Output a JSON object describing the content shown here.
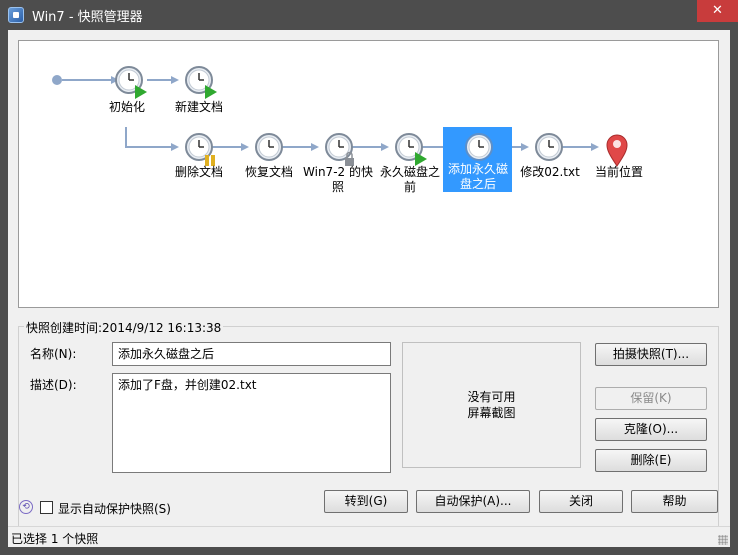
{
  "window": {
    "title": "Win7 - 快照管理器",
    "close_glyph": "✕"
  },
  "snapshots": {
    "root": "初始化",
    "new_doc": "新建文档",
    "delete_doc": "删除文档",
    "restore_doc": "恢复文档",
    "win7_snapshot": "Win7-2 的快照",
    "before_disk": "永久磁盘之前",
    "after_disk": "添加永久磁盘之后",
    "modify": "修改02.txt",
    "current": "当前位置"
  },
  "details": {
    "created_time": "快照创建时间:2014/9/12 16:13:38",
    "name_label": "名称(N):",
    "name_value": "添加永久磁盘之后",
    "desc_label": "描述(D):",
    "desc_value": "添加了F盘，并创建02.txt",
    "preview_line1": "没有可用",
    "preview_line2": "屏幕截图"
  },
  "buttons": {
    "take_snapshot": "拍摄快照(T)...",
    "keep": "保留(K)",
    "clone": "克隆(O)...",
    "delete": "删除(E)",
    "goto": "转到(G)",
    "autoprotect": "自动保护(A)...",
    "close": "关闭",
    "help": "帮助"
  },
  "footer": {
    "show_autoprotect": "显示自动保护快照(S)",
    "status": "已选择 1 个快照"
  },
  "colors": {
    "selection": "#3399ff",
    "pin": "#e04848",
    "play": "#2fa82f",
    "pause": "#e0b020"
  }
}
